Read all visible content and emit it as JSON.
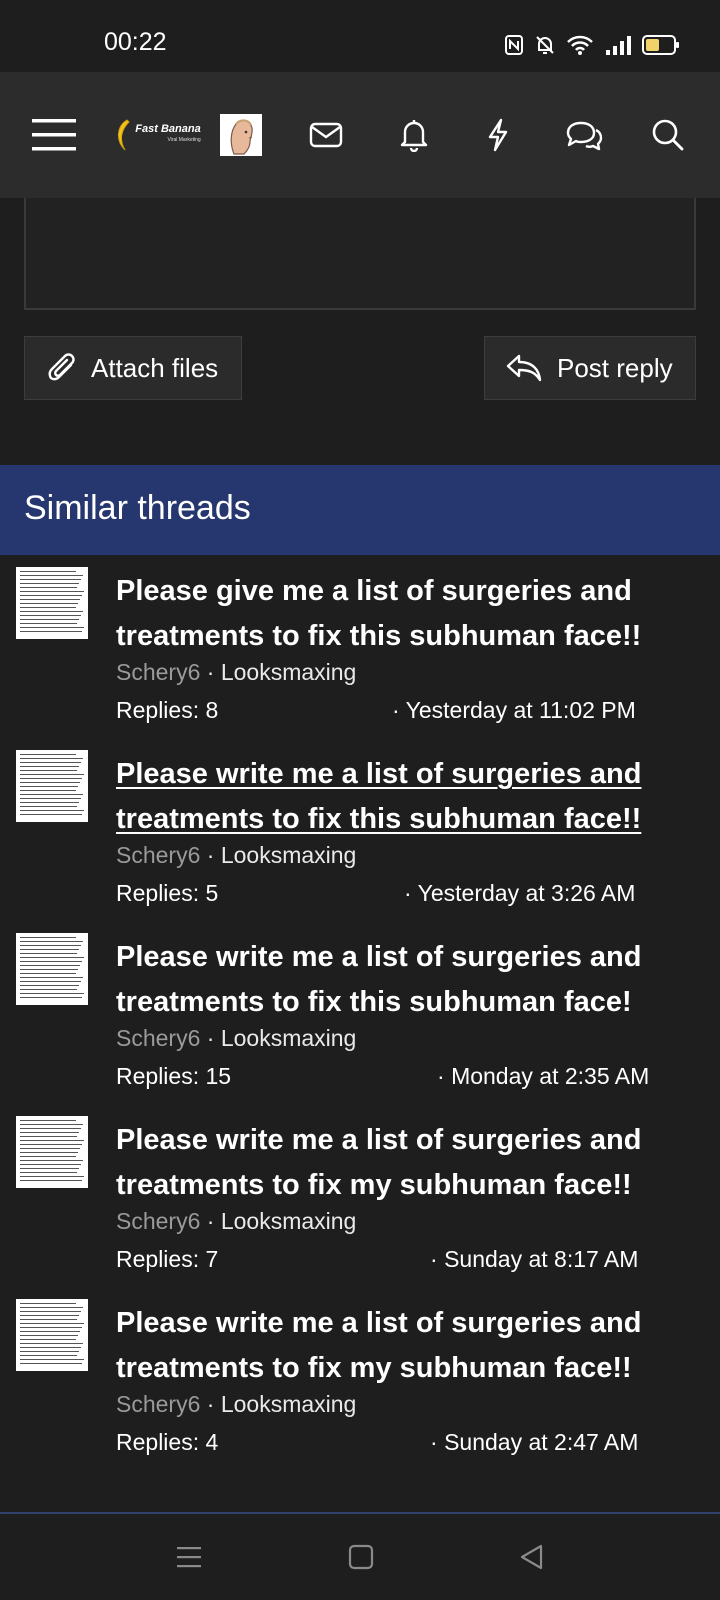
{
  "status_bar": {
    "time": "00:22"
  },
  "header": {
    "logo_text": "Fast Banana",
    "logo_subtext": "Viral Marketing"
  },
  "composer": {
    "attach_label": "Attach files",
    "post_label": "Post reply"
  },
  "similar": {
    "title": "Similar threads",
    "threads": [
      {
        "title": "Please give me a list of surgeries and treatments to fix this subhuman face!!",
        "author": "Schery6",
        "forum": "Looksmaxing",
        "replies": "Replies: 8",
        "date": "Yesterday at 11:02 PM"
      },
      {
        "title": "Please write me a list of surgeries and treatments to fix this subhuman face!!",
        "author": "Schery6",
        "forum": "Looksmaxing",
        "replies": "Replies: 5",
        "date": "Yesterday at 3:26 AM"
      },
      {
        "title": "Please write me a list of surgeries and treatments to fix this subhuman face!",
        "author": "Schery6",
        "forum": "Looksmaxing",
        "replies": "Replies: 15",
        "date": "Monday at 2:35 AM"
      },
      {
        "title": "Please write me a list of surgeries and treatments to fix my subhuman face!!",
        "author": "Schery6",
        "forum": "Looksmaxing",
        "replies": "Replies: 7",
        "date": "Sunday at 8:17 AM"
      },
      {
        "title": "Please write me a list of surgeries and treatments to fix my subhuman face!!",
        "author": "Schery6",
        "forum": "Looksmaxing",
        "replies": "Replies: 4",
        "date": "Sunday at 2:47 AM"
      }
    ]
  },
  "colors": {
    "background": "#1e1e1e",
    "topbar": "#2c2c2c",
    "section_header": "#263770",
    "muted_text": "#9a9a9a",
    "battery": "#f2d36b"
  }
}
